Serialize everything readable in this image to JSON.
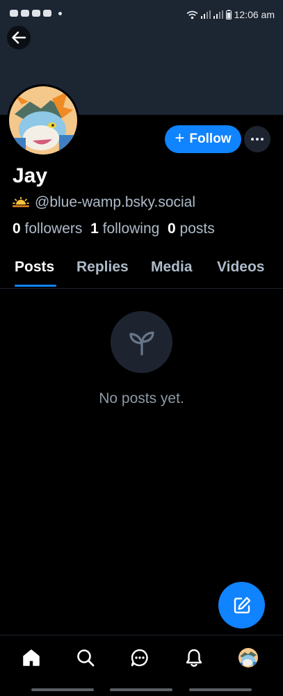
{
  "statusbar": {
    "time": "12:06 am"
  },
  "profile": {
    "display_name": "Jay",
    "handle": "@blue-wamp.bsky.social",
    "follow_label": "Follow",
    "stats": {
      "followers_count": "0",
      "followers_label": "followers",
      "following_count": "1",
      "following_label": "following",
      "posts_count": "0",
      "posts_label": "posts"
    }
  },
  "tabs": [
    {
      "label": "Posts",
      "active": true
    },
    {
      "label": "Replies"
    },
    {
      "label": "Media"
    },
    {
      "label": "Videos"
    }
  ],
  "empty_state": {
    "message": "No posts yet."
  },
  "icons": {
    "back": "arrow-left-icon",
    "more": "ellipsis-icon",
    "empty": "sprout-icon",
    "compose": "compose-icon",
    "nav": [
      "home-icon",
      "search-icon",
      "chat-icon",
      "bell-icon",
      "profile-avatar"
    ]
  },
  "colors": {
    "accent": "#1083fe",
    "background": "#000000",
    "banner": "#1c2532",
    "muted_text": "#aebbc9"
  }
}
